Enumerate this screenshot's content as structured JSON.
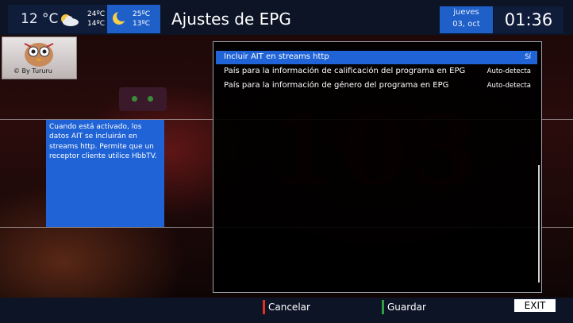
{
  "header": {
    "title": "Ajustes de EPG",
    "weather": {
      "current_temp": "12 °C",
      "today_high": "24ºC",
      "today_low": "14ºC",
      "today_icon": "partly-cloudy-icon",
      "tonight_high": "25ºC",
      "tonight_low": "13ºC",
      "tonight_icon": "moon-icon"
    },
    "date": {
      "weekday": "jueves",
      "day": "03, oct"
    },
    "clock": "01:36"
  },
  "logo": {
    "caption": "© By Tururu"
  },
  "help": {
    "text": "Cuando está activado, los datos AIT se incluirán en streams http. Permite que un receptor cliente utilice HbbTV."
  },
  "settings": {
    "rows": [
      {
        "label": "Incluir AIT en streams http",
        "value": "Sí"
      },
      {
        "label": "País para la información de calificación del programa en EPG",
        "value": "Auto-detecta"
      },
      {
        "label": "País para la información de género del programa en EPG",
        "value": "Auto-detecta"
      }
    ]
  },
  "footer": {
    "red_label": "Cancelar",
    "green_label": "Guardar",
    "exit_label": "EXIT"
  },
  "colors": {
    "selection": "#1f63d6",
    "header_bg": "#0c1426",
    "red_key": "#e03020",
    "green_key": "#2ea043"
  }
}
